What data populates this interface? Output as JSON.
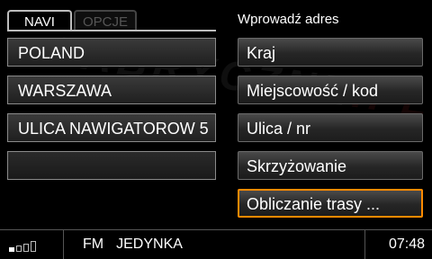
{
  "tabs": [
    {
      "label": "NAVI",
      "active": true
    },
    {
      "label": "OPCJE",
      "active": false
    }
  ],
  "address_fields": [
    "POLAND",
    "WARSZAWA",
    "ULICA NAWIGATOROW 5",
    ""
  ],
  "menu": {
    "title": "Wprowadź adres",
    "items": [
      "Kraj",
      "Miejscowość / kod",
      "Ulica / nr",
      "Skrzyżowanie",
      "Obliczanie trasy ..."
    ],
    "focused_index": 4,
    "focus_color": "#ff8a00"
  },
  "watermark": {
    "text": "FABRYCZNE",
    "suffix": ".PL"
  },
  "statusbar": {
    "signal_level": 1,
    "signal_bars": 4,
    "radio_band": "FM",
    "station": "JEDYNKA",
    "time": "07:48"
  }
}
